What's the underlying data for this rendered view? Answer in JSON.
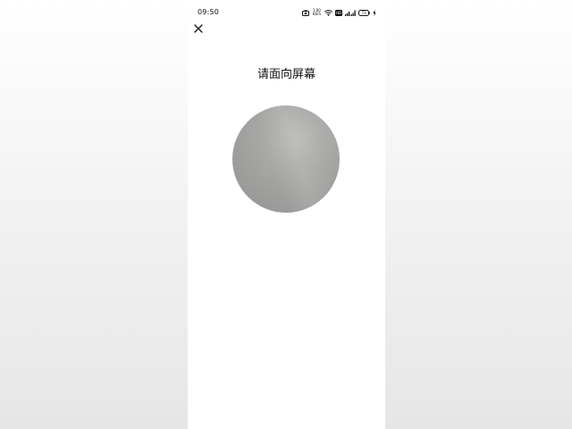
{
  "status_bar": {
    "time": "09:50",
    "network_speed_value": "1.00",
    "network_speed_unit": "KB/S",
    "battery_level": "73",
    "icons": [
      "camera-icon",
      "network-speed-icon",
      "wifi-icon",
      "volte-icon",
      "signal-icon",
      "battery-icon",
      "charging-icon"
    ]
  },
  "header": {
    "close_icon": "close-icon"
  },
  "main": {
    "title": "请面向屏幕"
  },
  "colors": {
    "page_background": "#ffffff",
    "outer_background": "#ececec",
    "text": "#111111",
    "camera_preview": "#a3a3a2"
  }
}
